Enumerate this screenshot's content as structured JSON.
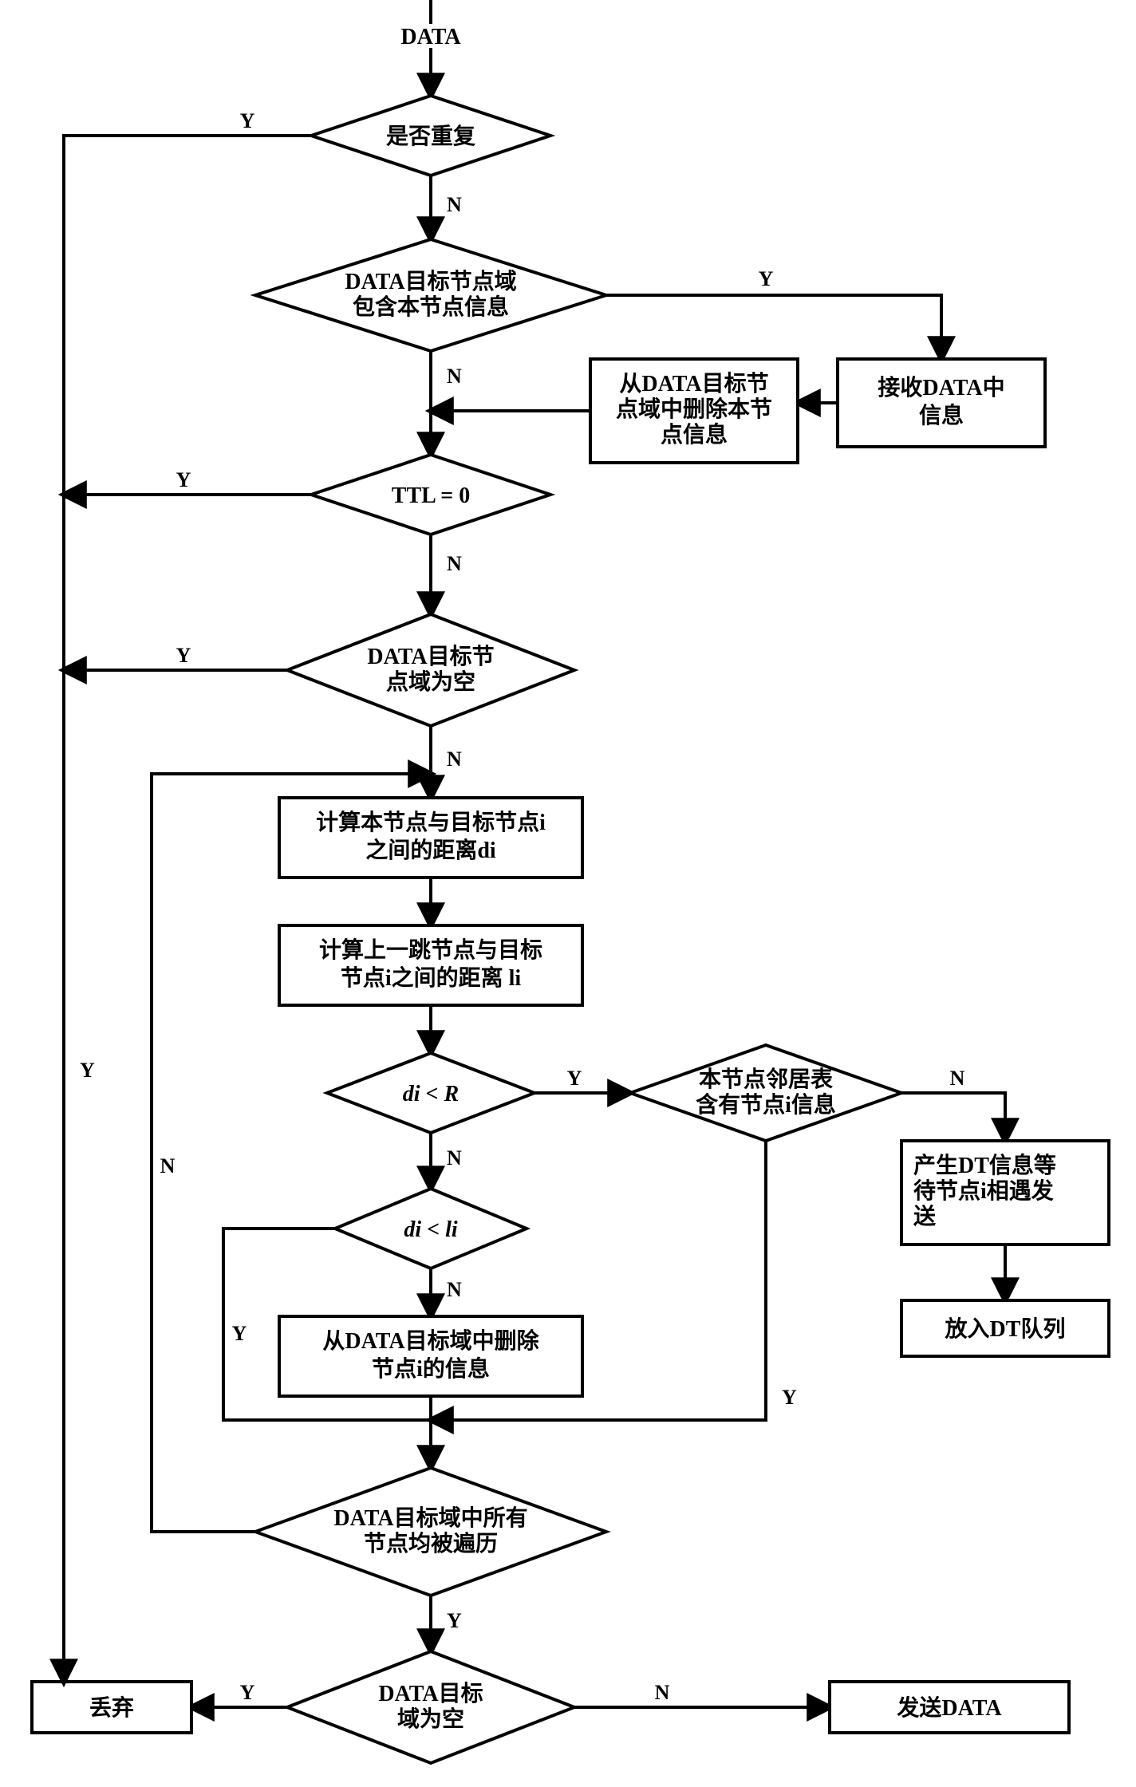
{
  "nodes": {
    "start": "DATA",
    "d1": "是否重复",
    "d2_l1": "DATA目标节点域",
    "d2_l2": "包含本节点信息",
    "p_recv_l1": "接收DATA中",
    "p_recv_l2": "信息",
    "p_del_self_l1": "从DATA目标节",
    "p_del_self_l2": "点域中删除本节",
    "p_del_self_l3": "点信息",
    "d3": "TTL = 0",
    "d4_l1": "DATA目标节",
    "d4_l2": "点域为空",
    "p_di_l1": "计算本节点与目标节点i",
    "p_di_l2": "之间的距离di",
    "p_li_l1": "计算上一跳节点与目标",
    "p_li_l2": "节点i之间的距离 li",
    "d5": "di < R",
    "d6_l1": "本节点邻居表",
    "d6_l2": "含有节点i信息",
    "p_dtmsg_l1": "产生DT信息等",
    "p_dtmsg_l2": "待节点i相遇发",
    "p_dtmsg_l3": "送",
    "p_dtq": "放入DT队列",
    "d7": "di < li",
    "p_deli_l1": "从DATA目标域中删除",
    "p_deli_l2": "节点i的信息",
    "d8_l1": "DATA目标域中所有",
    "d8_l2": "节点均被遍历",
    "d9_l1": "DATA目标",
    "d9_l2": "域为空",
    "p_discard": "丢弃",
    "p_send": "发送DATA"
  },
  "edges": {
    "Y": "Y",
    "N": "N"
  }
}
